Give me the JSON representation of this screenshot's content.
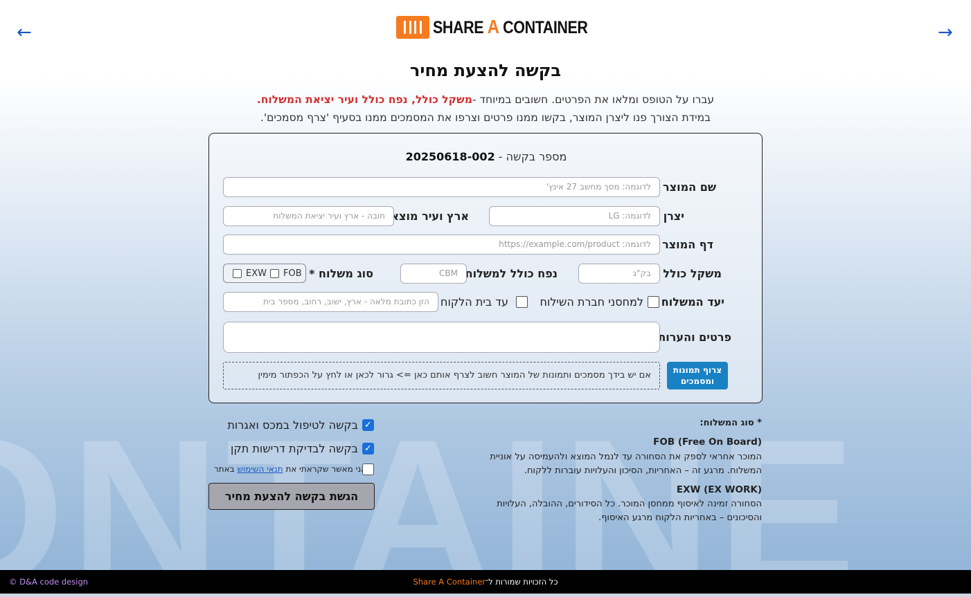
{
  "header": {
    "logo_text_1": "SHARE",
    "logo_text_a": "A",
    "logo_text_2": "CONTAINER",
    "nav_left": "←",
    "nav_right": "→"
  },
  "background_word": "ONTAINE",
  "page": {
    "title": "בקשה להצעת מחיר",
    "intro_line1_start": "עברו על הטופס ומלאו את הפרטים. חשובים במיוחד -",
    "intro_line1_highlight": "משקל כולל, נפח כולל ועיר יציאת המשלוח.",
    "intro_line2": "במידת הצורך פנו ליצרן המוצר, בקשו ממנו פרטים וצרפו את המסמכים ממנו בסעיף 'צרף מסמכים'."
  },
  "form": {
    "request_label": "מספר בקשה -",
    "request_number": "20250618-002",
    "product_name_label": "שם המוצר",
    "product_name_placeholder": "לדוגמה: מסך מחשב 27 אינץ'",
    "manufacturer_label": "יצרן",
    "manufacturer_placeholder": "לדוגמה: LG",
    "origin_label": "ארץ ועיר מוצא",
    "origin_placeholder": "חובה - ארץ  ועיר יציאת המשלוח",
    "product_page_label": "דף המוצר",
    "product_page_placeholder": "לדוגמה: https://example.com/product",
    "weight_label": "משקל כולל",
    "weight_placeholder": "בק\"ג",
    "volume_label": "נפח כולל למשלוח",
    "volume_placeholder": "CBM",
    "shipping_type_label": "סוג משלוח *",
    "shipping_fob": "FOB",
    "shipping_exw": "EXW",
    "destination_label": "יעד המשלוח",
    "dest_warehouse": "למחסני חברת השילוח",
    "dest_home": "עד בית הלקוח",
    "address_placeholder": "הזן כתובת מלאה - ארץ, ישוב, רחוב, מספר בית",
    "notes_label": "פרטים והערות",
    "attach_button": "צרוף תמונות ומסמכים",
    "dropzone_text": "אם יש בידך מסמכים ותמונות של המוצר חשוב לצרף אותם כאן => גרור לכאן או לחץ על הכפתור מימין"
  },
  "options": {
    "customs_label": "בקשה לטיפול במכס ואגרות",
    "customs_checked": true,
    "standards_label": "בקשה לבדיקת דרישות תקן",
    "standards_checked": true,
    "terms_prefix": "אני מאשר שקראתי את",
    "terms_link": "תנאי השימוש",
    "terms_suffix": "באתר",
    "terms_checked": false,
    "submit_label": "הגשת בקשה להצעת מחיר"
  },
  "shipping_info": {
    "title": "* סוג המשלוח:",
    "fob_title": "FOB (Free On Board)",
    "fob_text": "המוכר אחראי לספק את הסחורה עד לנמל המוצא ולהעמיסה על אוניית המשלוח. מרגע זה – האחריות, הסיכון והעלויות עוברות ללקוח.",
    "exw_title": "EXW (EX WORK)",
    "exw_text": "הסחורה זמינה לאיסוף ממחסן המוכר. כל הסידורים, ההובלה, העלויות והסיכונים – באחריות הלקוח מרגע האיסוף."
  },
  "footer": {
    "credit": "© D&A code design",
    "rights_prefix": "כל הזכויות שמורות ל־",
    "rights_brand": "Share A Container"
  },
  "colors": {
    "brand_orange": "#f47b20",
    "accent_blue": "#1982c4",
    "highlight_red": "#d32f2f"
  }
}
